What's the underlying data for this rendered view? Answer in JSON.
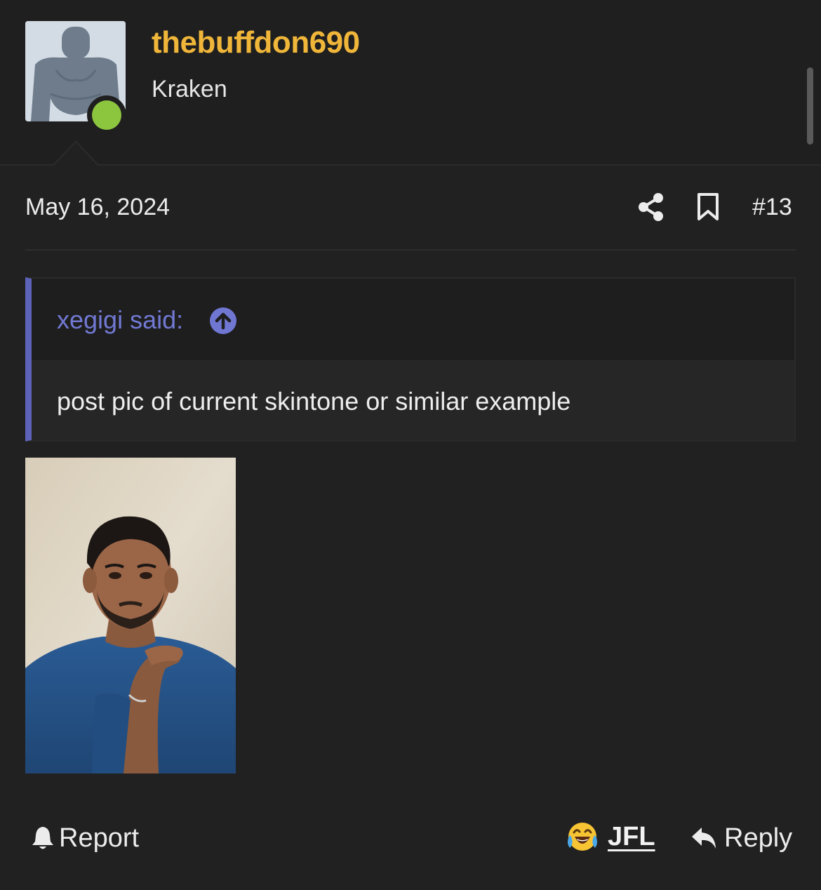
{
  "author": {
    "username": "thebuffdon690",
    "user_title": "Kraken",
    "online": true,
    "username_color": "#f0b63a",
    "online_color": "#8cc63f"
  },
  "post": {
    "date": "May 16, 2024",
    "number": "#13",
    "share_icon": "share-icon",
    "bookmark_icon": "bookmark-icon"
  },
  "quote": {
    "author_label": "xegigi said:",
    "jump_icon": "arrow-up-circle-icon",
    "body": "post pic of current skintone or similar example",
    "accent_color": "#5c62b8"
  },
  "attachment": {
    "type": "photo",
    "description_icon": "photo-of-man-in-blue-shirt"
  },
  "footer": {
    "report_label": "Report",
    "reaction_label": "JFL",
    "reply_label": "Reply",
    "report_icon": "bell-icon",
    "reaction_icon": "laughing-crying-emoji-icon",
    "reply_icon": "reply-arrow-icon"
  }
}
